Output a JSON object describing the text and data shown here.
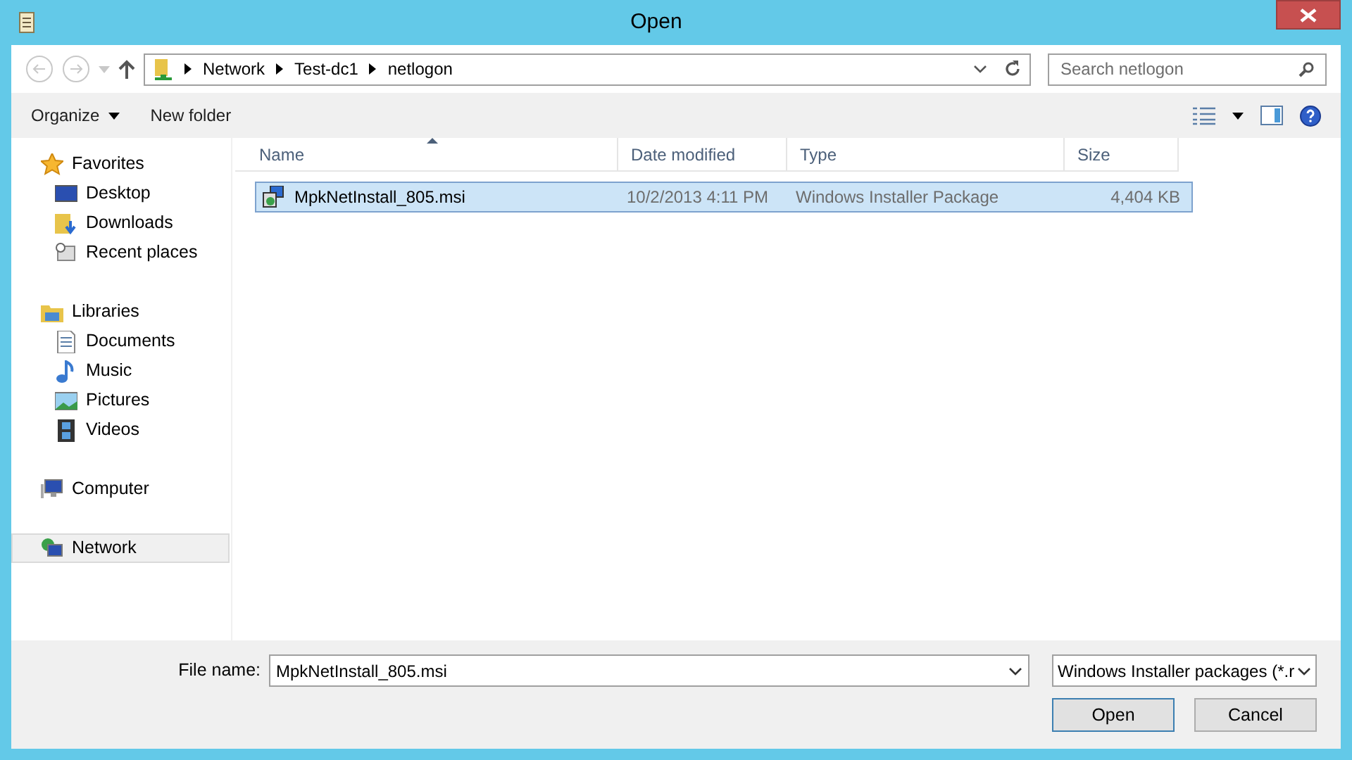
{
  "window": {
    "title": "Open"
  },
  "address": {
    "crumbs": [
      "Network",
      "Test-dc1",
      "netlogon"
    ]
  },
  "search": {
    "placeholder": "Search netlogon"
  },
  "toolbar": {
    "organize": "Organize",
    "new_folder": "New folder"
  },
  "sidebar": {
    "groups": [
      {
        "label": "Favorites",
        "selected": false,
        "children": [
          {
            "label": "Desktop",
            "selected": false
          },
          {
            "label": "Downloads",
            "selected": false
          },
          {
            "label": "Recent places",
            "selected": false
          }
        ]
      },
      {
        "label": "Libraries",
        "selected": false,
        "children": [
          {
            "label": "Documents",
            "selected": false
          },
          {
            "label": "Music",
            "selected": false
          },
          {
            "label": "Pictures",
            "selected": false
          },
          {
            "label": "Videos",
            "selected": false
          }
        ]
      },
      {
        "label": "Computer",
        "selected": false
      },
      {
        "label": "Network",
        "selected": true
      }
    ]
  },
  "table": {
    "columns": [
      "Name",
      "Date modified",
      "Type",
      "Size"
    ],
    "rows": [
      {
        "name": "MpkNetInstall_805.msi",
        "date": "10/2/2013 4:11 PM",
        "type": "Windows Installer Package",
        "size": "4,404 KB",
        "selected": true
      }
    ]
  },
  "footer": {
    "file_name_label": "File name:",
    "file_name": "MpkNetInstall_805.msi",
    "filter": "Windows Installer packages (*.r",
    "buttons": [
      "Open",
      "Cancel"
    ]
  }
}
